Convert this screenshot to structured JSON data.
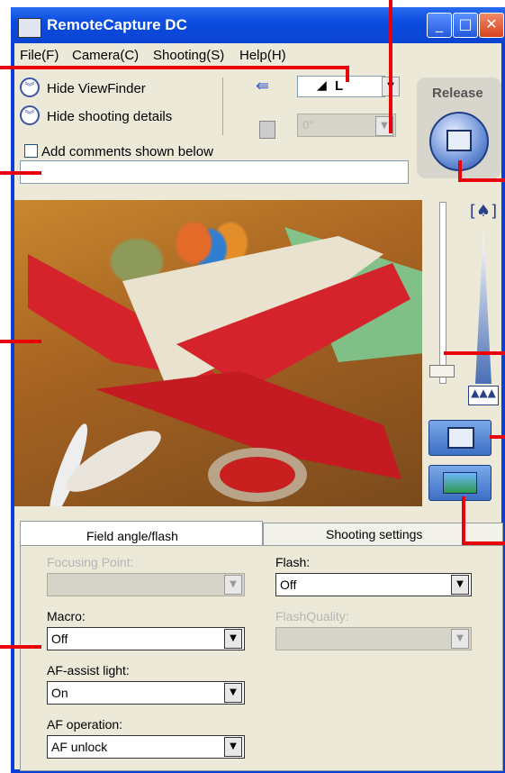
{
  "window": {
    "title": "RemoteCapture DC"
  },
  "menu": [
    "File(F)",
    "Camera(C)",
    "Shooting(S)",
    "Help(H)"
  ],
  "toolbar": {
    "hide_viewfinder": "Hide ViewFinder",
    "hide_shooting_details": "Hide shooting details",
    "add_comments": "Add comments shown below",
    "image_size_value": "L",
    "rotation_value": "0°",
    "release_label": "Release"
  },
  "tabs": {
    "field_angle": "Field angle/flash",
    "shooting_settings": "Shooting settings"
  },
  "settings": {
    "focusing_point": {
      "label": "Focusing Point:",
      "value": ""
    },
    "macro": {
      "label": "Macro:",
      "value": "Off"
    },
    "af_assist": {
      "label": "AF-assist light:",
      "value": "On"
    },
    "af_operation": {
      "label": "AF operation:",
      "value": "AF unlock"
    },
    "flash": {
      "label": "Flash:",
      "value": "Off"
    },
    "flash_quality": {
      "label": "FlashQuality:",
      "value": ""
    }
  },
  "colors": {
    "title_bar": "#0a43d2",
    "annotation": "#e8000b",
    "panel": "#ece9d8"
  }
}
